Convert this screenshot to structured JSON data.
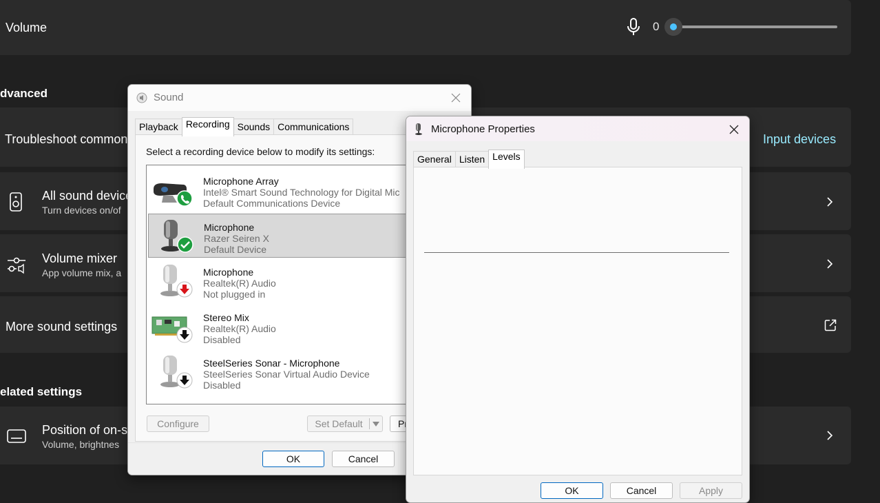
{
  "settings": {
    "volume_label": "Volume",
    "volume_value": "0",
    "volume_level": 0,
    "advanced_title": "dvanced",
    "troubleshoot_label": "Troubleshoot common",
    "input_devices_link": "Input devices",
    "all_sound_title": "All sound device",
    "all_sound_sub": "Turn devices on/of",
    "mixer_title": "Volume mixer",
    "mixer_sub": "App volume mix, a",
    "more_sound_title": "More sound settings",
    "related_title": "elated settings",
    "osd_title": "Position of on-sc",
    "osd_sub": "Volume, brightnes",
    "accent": "#4cc2ff"
  },
  "sound_dialog": {
    "title": "Sound",
    "tabs": [
      "Playback",
      "Recording",
      "Sounds",
      "Communications"
    ],
    "active_tab": "Recording",
    "instruction": "Select a recording device below to modify its settings:",
    "devices": [
      {
        "name": "Microphone Array",
        "line1": "Intel® Smart Sound Technology for Digital Mic",
        "line2": "Default Communications Device",
        "icon": "webcam-mic-icon",
        "badge": "phone-badge-icon"
      },
      {
        "name": "Microphone",
        "line1": "Razer Seiren X",
        "line2": "Default Device",
        "icon": "microphone-icon",
        "badge": "check-badge-icon",
        "selected": true
      },
      {
        "name": "Microphone",
        "line1": "Realtek(R) Audio",
        "line2": "Not plugged in",
        "icon": "microphone-icon",
        "badge": "red-down-arrow-icon"
      },
      {
        "name": "Stereo Mix",
        "line1": "Realtek(R) Audio",
        "line2": "Disabled",
        "icon": "sound-card-icon",
        "badge": "down-arrow-icon"
      },
      {
        "name": "SteelSeries Sonar - Microphone",
        "line1": "SteelSeries Sonar Virtual Audio Device",
        "line2": "Disabled",
        "icon": "microphone-icon",
        "badge": "down-arrow-icon"
      }
    ],
    "configure_label": "Configure",
    "set_default_label": "Set Default",
    "properties_label": "Pr",
    "ok_label": "OK",
    "cancel_label": "Cancel"
  },
  "mic_dialog": {
    "title": "Microphone Properties",
    "tabs": [
      "General",
      "Listen",
      "Levels"
    ],
    "active_tab": "Levels",
    "ok_label": "OK",
    "cancel_label": "Cancel",
    "apply_label": "Apply"
  }
}
